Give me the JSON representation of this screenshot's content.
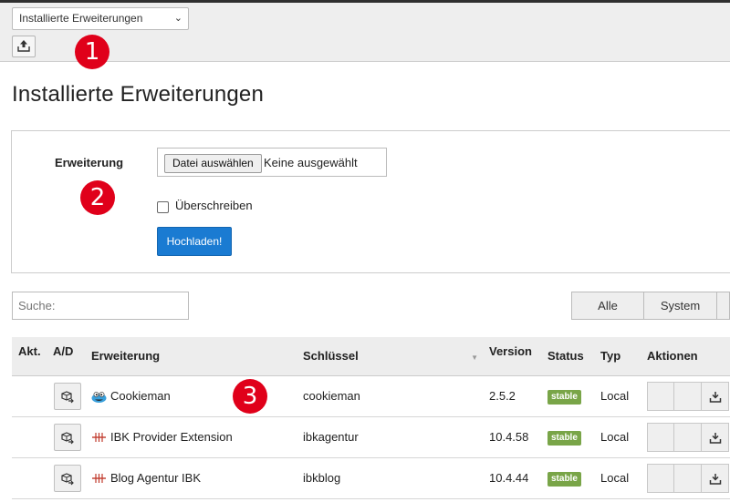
{
  "toolbar": {
    "menu_selected": "Installierte Erweiterungen",
    "upload_icon": "upload-icon"
  },
  "markers": [
    "1",
    "2",
    "3"
  ],
  "page": {
    "title": "Installierte Erweiterungen"
  },
  "upload_form": {
    "field_label": "Erweiterung",
    "file_button": "Datei auswählen",
    "file_status": "Keine ausgewählt",
    "overwrite_label": "Überschreiben",
    "submit_label": "Hochladen!"
  },
  "search": {
    "placeholder": "Suche:"
  },
  "filters": [
    "Alle",
    "System"
  ],
  "table": {
    "headers": {
      "active": "Akt.",
      "ad": "A/D",
      "extension": "Erweiterung",
      "key": "Schlüssel",
      "version": "Version",
      "status": "Status",
      "type": "Typ",
      "actions": "Aktionen"
    },
    "rows": [
      {
        "icon": "cookie-monster-icon",
        "name": "Cookieman",
        "key": "cookieman",
        "version": "2.5.2",
        "status": "stable",
        "type": "Local"
      },
      {
        "icon": "ibk-logo-icon",
        "name": "IBK Provider Extension",
        "key": "ibkagentur",
        "version": "10.4.58",
        "status": "stable",
        "type": "Local"
      },
      {
        "icon": "ibk-logo-icon",
        "name": "Blog Agentur IBK",
        "key": "ibkblog",
        "version": "10.4.44",
        "status": "stable",
        "type": "Local"
      }
    ]
  },
  "colors": {
    "marker": "#e0001a",
    "primary_button": "#1a7bd2",
    "stable_badge": "#79a548"
  }
}
